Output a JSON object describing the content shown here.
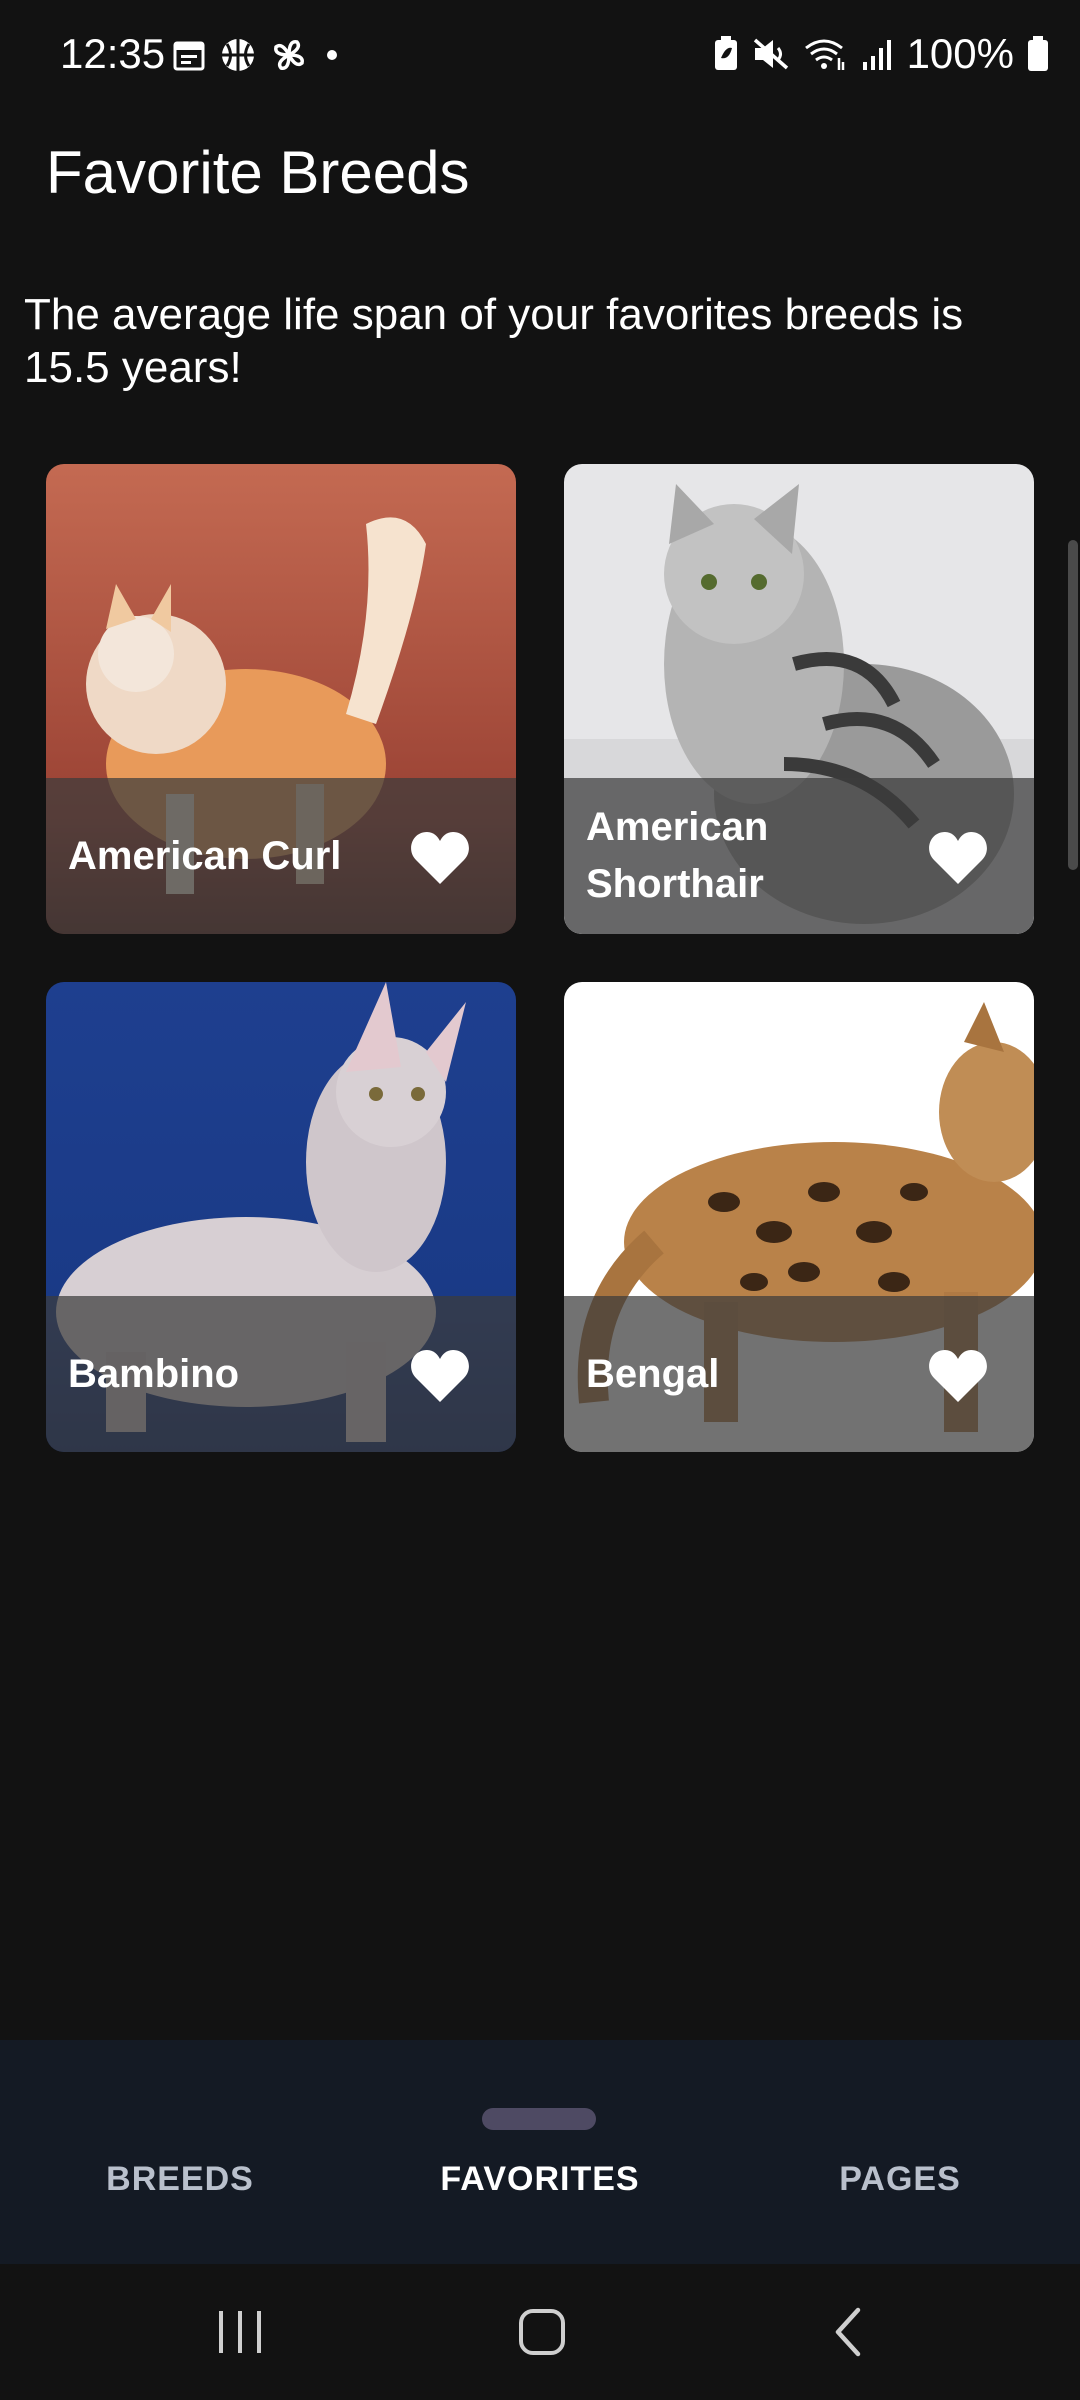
{
  "status_bar": {
    "time": "12:35",
    "battery_percent": "100%",
    "left_icons": [
      "calendar-icon",
      "basketball-icon",
      "pinwheel-icon",
      "dot-icon"
    ],
    "right_icons": [
      "battery-saver-icon",
      "mute-icon",
      "wifi-icon",
      "signal-icon",
      "battery-icon"
    ]
  },
  "header": {
    "title": "Favorite Breeds"
  },
  "summary": {
    "text": "The average life span of your favorites breeds is 15.5 years!"
  },
  "breeds": [
    {
      "name": "American Curl",
      "favorite": true,
      "icon": "heart-icon"
    },
    {
      "name": "American Shorthair",
      "favorite": true,
      "icon": "heart-icon"
    },
    {
      "name": "Bambino",
      "favorite": true,
      "icon": "heart-icon"
    },
    {
      "name": "Bengal",
      "favorite": true,
      "icon": "heart-icon"
    }
  ],
  "bottom_nav": {
    "items": [
      {
        "label": "BREEDS",
        "active": false
      },
      {
        "label": "FAVORITES",
        "active": true
      },
      {
        "label": "PAGES",
        "active": false
      }
    ]
  },
  "system_nav": {
    "buttons": [
      "recents-icon",
      "home-icon",
      "back-icon"
    ]
  },
  "colors": {
    "background": "#121212",
    "nav_background": "#141a24",
    "indicator": "#4e4a63",
    "text": "#ffffff"
  }
}
